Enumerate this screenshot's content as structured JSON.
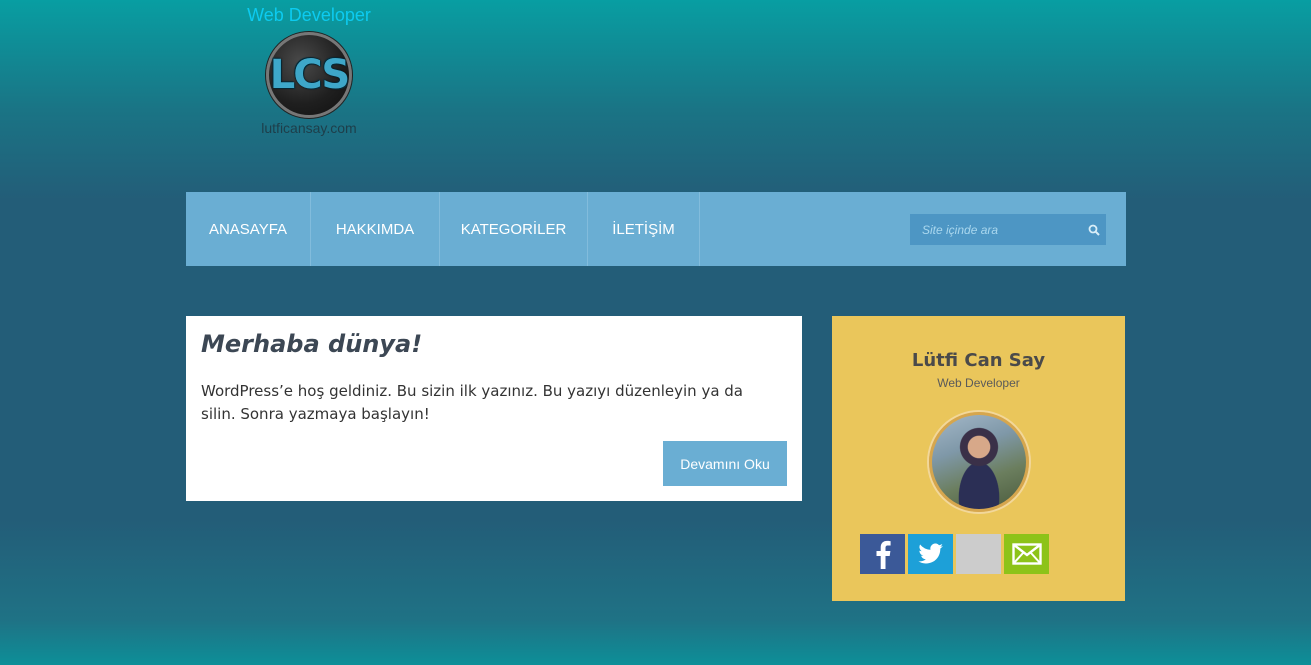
{
  "header": {
    "tagline": "Web Developer",
    "logo_text": "LCS",
    "domain": "lutficansay.com"
  },
  "nav": {
    "items": [
      {
        "label": "ANASAYFA"
      },
      {
        "label": "HAKKIMDA"
      },
      {
        "label": "KATEGORİLER"
      },
      {
        "label": "İLETİŞİM"
      }
    ],
    "search": {
      "placeholder": "Site içinde ara",
      "icon": "search-icon"
    }
  },
  "post": {
    "title": "Merhaba dünya!",
    "excerpt": "WordPress’e hoş geldiniz. Bu sizin ilk yazınız. Bu yazıyı düzenleyin ya da silin. Sonra yazmaya başlayın!",
    "read_more": "Devamını Oku"
  },
  "profile": {
    "name": "Lütfi Can Say",
    "role": "Web Developer",
    "socials": [
      {
        "icon": "facebook-icon",
        "color": "#3b5998"
      },
      {
        "icon": "twitter-icon",
        "color": "#1da0d8"
      },
      {
        "icon": "blank-icon",
        "color": "#cccccc"
      },
      {
        "icon": "mail-icon",
        "color": "#8dc319"
      }
    ]
  },
  "colors": {
    "nav_bg": "#6aaed3",
    "widget_bg": "#eac65b",
    "tagline": "#0ccbf0"
  }
}
